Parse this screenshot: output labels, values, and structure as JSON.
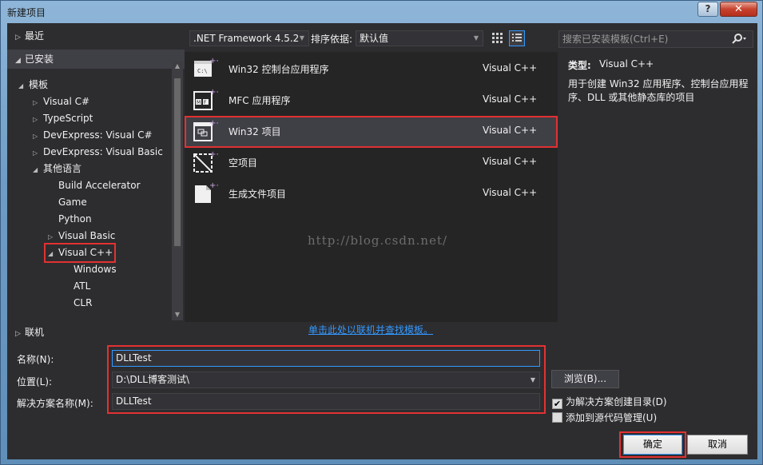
{
  "window": {
    "title": "新建项目",
    "help_label": "?",
    "close_label": "✕"
  },
  "left_panel": {
    "recent": "最近",
    "installed": "已安装",
    "online": "联机",
    "tree": [
      {
        "label": "模板",
        "level": 0,
        "state": "expanded"
      },
      {
        "label": "Visual C#",
        "level": 1,
        "state": "collapsed"
      },
      {
        "label": "TypeScript",
        "level": 1,
        "state": "collapsed"
      },
      {
        "label": "DevExpress: Visual C#",
        "level": 1,
        "state": "collapsed"
      },
      {
        "label": "DevExpress: Visual Basic",
        "level": 1,
        "state": "collapsed"
      },
      {
        "label": "其他语言",
        "level": 1,
        "state": "expanded"
      },
      {
        "label": "Build Accelerator",
        "level": 2,
        "state": "leaf"
      },
      {
        "label": "Game",
        "level": 2,
        "state": "leaf"
      },
      {
        "label": "Python",
        "level": 2,
        "state": "leaf"
      },
      {
        "label": "Visual Basic",
        "level": 2,
        "state": "collapsed"
      },
      {
        "label": "Visual C++",
        "level": 2,
        "state": "expanded"
      },
      {
        "label": "Windows",
        "level": 3,
        "state": "leaf"
      },
      {
        "label": "ATL",
        "level": 3,
        "state": "leaf"
      },
      {
        "label": "CLR",
        "level": 3,
        "state": "leaf"
      }
    ]
  },
  "toolbar": {
    "framework": ".NET Framework 4.5.2",
    "sort_label": "排序依据:",
    "sort_value": "默认值",
    "search_placeholder": "搜索已安装模板(Ctrl+E)"
  },
  "templates": [
    {
      "name": "Win32 控制台应用程序",
      "lang": "Visual C++",
      "icon": "console-app-icon"
    },
    {
      "name": "MFC 应用程序",
      "lang": "Visual C++",
      "icon": "mfc-app-icon"
    },
    {
      "name": "Win32 项目",
      "lang": "Visual C++",
      "icon": "win32-project-icon",
      "selected": true
    },
    {
      "name": "空项目",
      "lang": "Visual C++",
      "icon": "empty-project-icon"
    },
    {
      "name": "生成文件项目",
      "lang": "Visual C++",
      "icon": "makefile-project-icon"
    }
  ],
  "watermark": "http://blog.csdn.net/",
  "description": {
    "type_label": "类型:",
    "type_value": "Visual C++",
    "text": "用于创建 Win32 应用程序、控制台应用程序、DLL 或其他静态库的项目"
  },
  "online_link": "单击此处以联机并查找模板。",
  "form": {
    "name_label": "名称(N):",
    "name_value": "DLLTest",
    "location_label": "位置(L):",
    "location_value": "D:\\DLL博客测试\\",
    "solution_label": "解决方案名称(M):",
    "solution_value": "DLLTest",
    "browse_label": "浏览(B)...",
    "create_dir_label": "为解决方案创建目录(D)",
    "create_dir_checked": true,
    "source_control_label": "添加到源代码管理(U)",
    "source_control_checked": false,
    "ok_label": "确定",
    "cancel_label": "取消"
  },
  "colors": {
    "background": "#2d2d30",
    "accent": "#3399ff",
    "annotation": "#e23131",
    "link": "#3399ff"
  }
}
